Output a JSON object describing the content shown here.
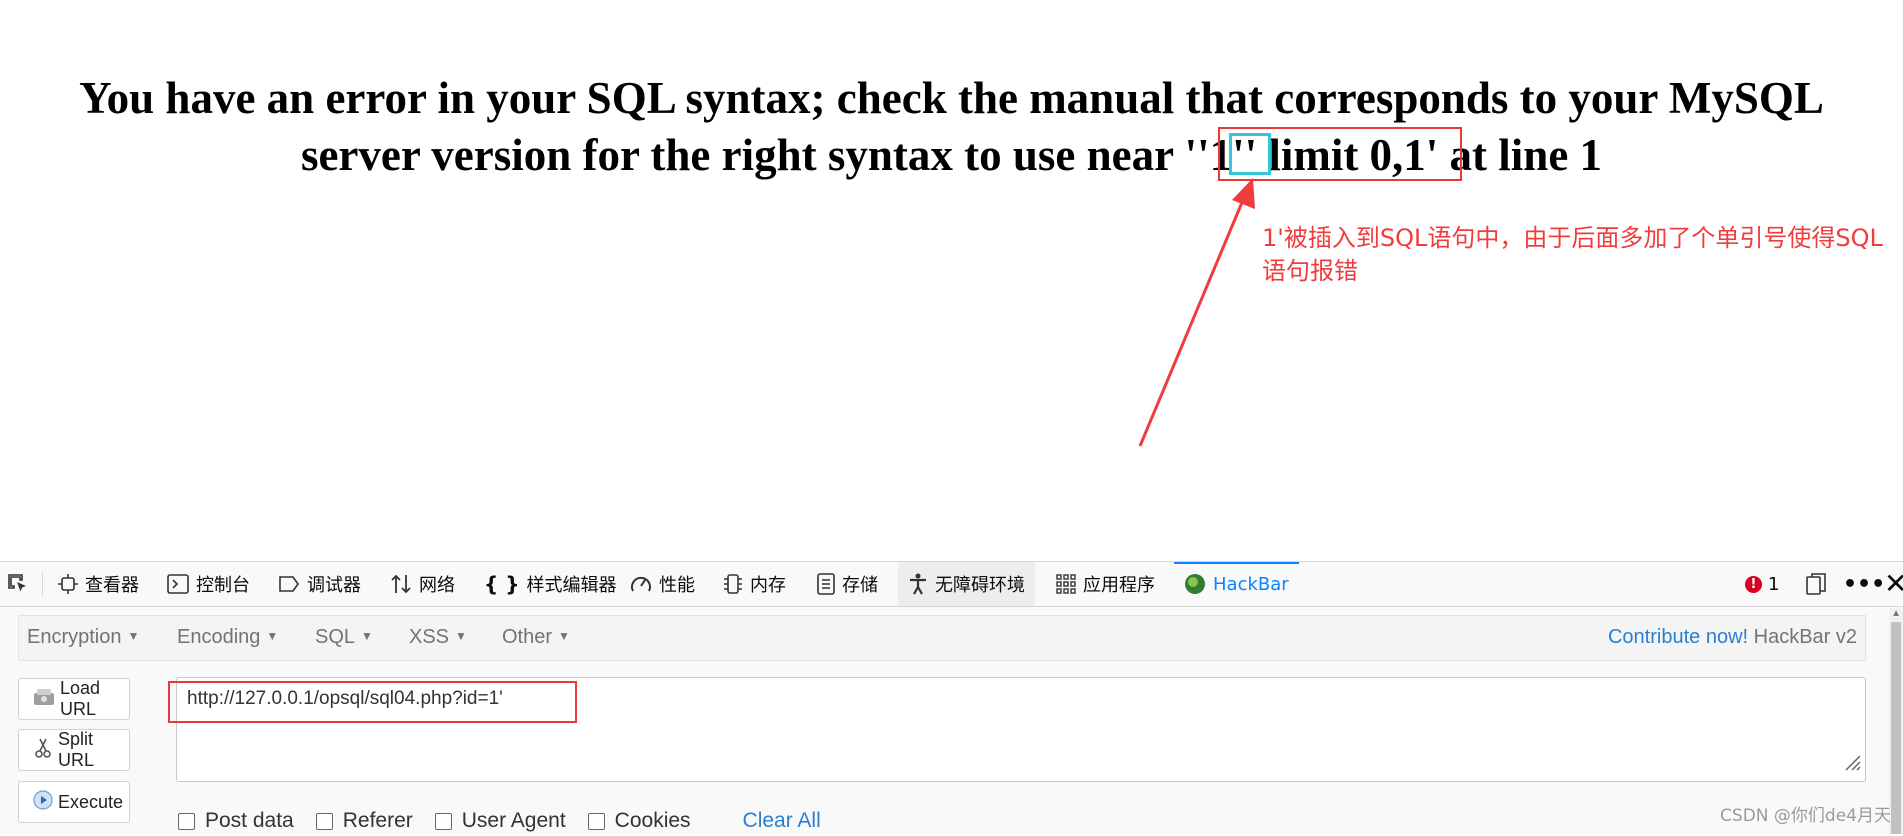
{
  "page": {
    "error_line1": "You have an error in your SQL syntax; check the manual that corresponds to your MySQL",
    "error_line2": "server version for the right syntax to use near ''1'' limit 0,1' at line 1"
  },
  "annotation": {
    "text": "1'被插入到SQL语句中，由于后面多加了个单引号使得SQL语句报错",
    "color": "#f03c3c"
  },
  "devtools": {
    "tabs": [
      {
        "label": "查看器",
        "icon": "inspector-icon"
      },
      {
        "label": "控制台",
        "icon": "console-icon"
      },
      {
        "label": "调试器",
        "icon": "debugger-icon"
      },
      {
        "label": "网络",
        "icon": "network-icon"
      },
      {
        "label": "样式编辑器",
        "icon": "style-editor-icon"
      },
      {
        "label": "性能",
        "icon": "performance-icon"
      },
      {
        "label": "内存",
        "icon": "memory-icon"
      },
      {
        "label": "存储",
        "icon": "storage-icon"
      },
      {
        "label": "无障碍环境",
        "icon": "accessibility-icon"
      },
      {
        "label": "应用程序",
        "icon": "application-icon"
      },
      {
        "label": "HackBar",
        "icon": "hackbar-icon"
      }
    ],
    "error_count": "1"
  },
  "hackbar": {
    "menus": [
      "Encryption",
      "Encoding",
      "SQL",
      "XSS",
      "Other"
    ],
    "contribute_link": "Contribute now!",
    "version": "HackBar v2",
    "buttons": {
      "load": "Load URL",
      "split": "Split URL",
      "execute": "Execute"
    },
    "url_value": "http://127.0.0.1/opsql/sql04.php?id=1'",
    "checkboxes": [
      "Post data",
      "Referer",
      "User Agent",
      "Cookies"
    ],
    "clear_all": "Clear All"
  },
  "watermark": "CSDN @你们de4月天",
  "colors": {
    "accent": "#0a84ff",
    "link": "#2a7fcf",
    "annotation_red": "#e83a3a",
    "highlight_cyan": "#33c7d8"
  }
}
